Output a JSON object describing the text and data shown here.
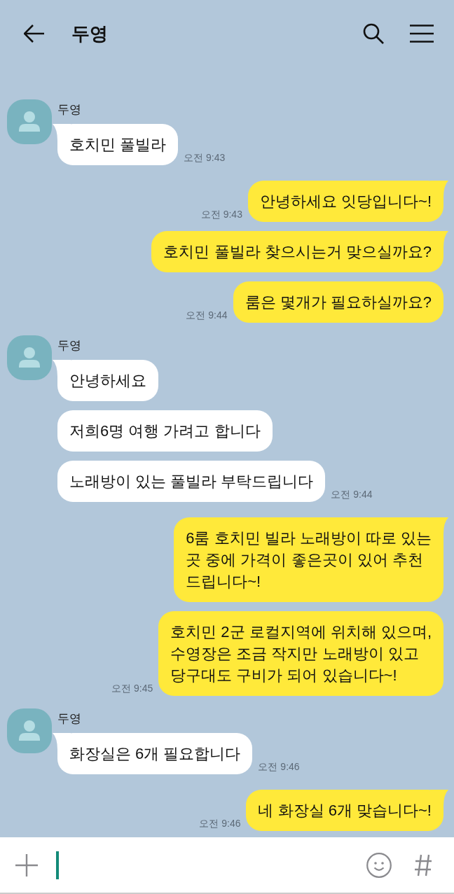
{
  "header": {
    "title": "두영"
  },
  "messages": [
    {
      "kind": "received",
      "sender": "두영",
      "bubbles": [
        "호치민 풀빌라"
      ],
      "time": "오전 9:43"
    },
    {
      "kind": "sent",
      "bubbles": [
        "안녕하세요 잇당입니다~!"
      ],
      "time": "오전 9:43"
    },
    {
      "kind": "sent",
      "bubbles": [
        "호치민 풀빌라 찾으시는거 맞으실까요?",
        "룸은 몇개가 필요하실까요?"
      ],
      "time": "오전 9:44"
    },
    {
      "kind": "received",
      "sender": "두영",
      "bubbles": [
        "안녕하세요",
        "저희6명 여행 가려고 합니다",
        "노래방이 있는 풀빌라 부탁드립니다"
      ],
      "time": "오전 9:44"
    },
    {
      "kind": "sent",
      "bubbles": [
        "6룸 호치민 빌라 노래방이 따로 있는\n곳 중에 가격이 좋은곳이 있어 추천\n드립니다~!",
        "호치민 2군 로컬지역에 위치해 있으며,\n수영장은 조금 작지만 노래방이 있고\n당구대도 구비가 되어 있습니다~!"
      ],
      "time": "오전 9:45"
    },
    {
      "kind": "received",
      "sender": "두영",
      "bubbles": [
        "화장실은 6개 필요합니다"
      ],
      "time": "오전 9:46"
    },
    {
      "kind": "sent",
      "bubbles": [
        "네 화장실 6개 맞습니다~!"
      ],
      "time": "오전 9:46"
    }
  ]
}
